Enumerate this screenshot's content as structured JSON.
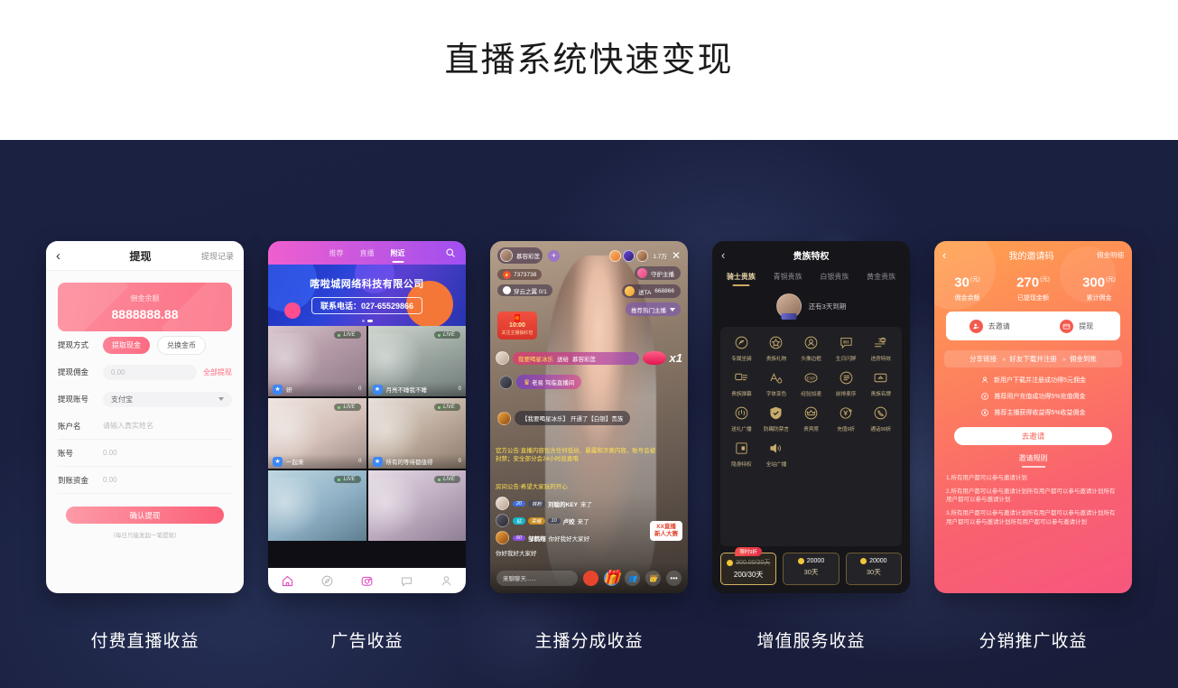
{
  "header": {
    "title": "直播系统快速变现"
  },
  "captions": [
    "付费直播收益",
    "广告收益",
    "主播分成收益",
    "增值服务收益",
    "分销推广收益"
  ],
  "phone_withdraw": {
    "nav": {
      "back": "‹",
      "title": "提现",
      "right": "提现记录"
    },
    "balance_label": "佣金余额",
    "balance_value": "8888888.88",
    "method_label": "提现方式",
    "method_cash": "提取现金",
    "method_coin": "兑换金币",
    "amount_label": "提现佣金",
    "amount_placeholder": "0.00",
    "amount_all": "全部提现",
    "account_label": "提现账号",
    "account_value": "支付宝",
    "name_label": "账户名",
    "name_placeholder": "请输入真实姓名",
    "number_label": "账号",
    "number_placeholder": "0.00",
    "arrive_label": "到账资金",
    "arrive_placeholder": "0.00",
    "submit": "确认提现",
    "note": "（每日只能发起一笔提现）"
  },
  "phone_ads": {
    "tabs": [
      "推荐",
      "直播",
      "附近"
    ],
    "active_tab": "附近",
    "search_icon": "search-icon",
    "banner_title": "喀啦城网络科技有限公司",
    "banner_phone": "联系电话：027-65529866",
    "live_badge": "LIVE",
    "cards": [
      {
        "name": "妍",
        "viewers": "0"
      },
      {
        "name": "月亮不睡我不睡",
        "viewers": "0"
      },
      {
        "name": "一起来",
        "viewers": "0"
      },
      {
        "name": "所有的等待都值得",
        "viewers": "0"
      },
      {
        "name": "",
        "viewers": ""
      },
      {
        "name": "",
        "viewers": ""
      }
    ],
    "tabbar": [
      "home-icon",
      "compass-icon",
      "camera-icon",
      "chat-icon",
      "profile-icon"
    ]
  },
  "phone_live": {
    "anchor_name": "慕容彩莲",
    "follow_plus": "+",
    "viewer_count": "1.7万",
    "close_icon": "close-icon",
    "hot_value": "7373738",
    "task_text": "穿云之翼 0/1",
    "guard_label": "守护主播",
    "send_label": "送TA",
    "send_value": "668866",
    "recommend_label": "推荐热门主播",
    "redpacket_time": "10:00",
    "redpacket_text": "关注主播抽红包",
    "gift_sender": "我要喝星冰乐",
    "gift_action": "送给",
    "gift_target": "慕容彩莲",
    "gift_multi": "x1",
    "enter_user": "老易",
    "enter_text": "驾临直播间",
    "noble_user": "【我要喝星冰乐】",
    "noble_text": "开通了【白银】贵族",
    "official_notice": "官方公告:直播内容包含任何低俗、暴露和涉黄内容，账号会被封禁；安全部分会24小时巡查哦",
    "room_notice": "房间公告:希望大家玩的开心",
    "chat": [
      {
        "level": "20",
        "tag": "铁粉",
        "user": "刘聪的KEY",
        "text": "来了"
      },
      {
        "level": "钻",
        "tag": "荣耀",
        "tag2": "10",
        "user": "卢姣",
        "text": "来了"
      },
      {
        "level": "60",
        "user": "邹鹤翔",
        "text": "你好我好大家好"
      },
      {
        "user": "",
        "text": "你好我好大家好"
      }
    ],
    "ad_badge_line1": "XX直播",
    "ad_badge_line2": "新人大赛",
    "input_placeholder": "来聊聊天......"
  },
  "phone_noble": {
    "nav_title": "贵族特权",
    "back": "‹",
    "tabs": [
      "骑士贵族",
      "青铜贵族",
      "白银贵族",
      "黄金贵族"
    ],
    "active_tab": "骑士贵族",
    "expiry": "还有3天到期",
    "privileges": [
      {
        "label": "专属坐骑",
        "icon": "mount-icon"
      },
      {
        "label": "贵族礼物",
        "icon": "star-icon"
      },
      {
        "label": "头像边框",
        "icon": "avatar-frame-icon"
      },
      {
        "label": "生日闪屏",
        "icon": "hi-bubble-icon"
      },
      {
        "label": "进房特效",
        "icon": "enter-effect-icon"
      },
      {
        "label": "贵族弹幕",
        "icon": "danmaku-icon"
      },
      {
        "label": "字体变色",
        "icon": "font-color-icon"
      },
      {
        "label": "经验加速",
        "icon": "exp-icon"
      },
      {
        "label": "前排麦序",
        "icon": "queue-icon"
      },
      {
        "label": "贵族名牌",
        "icon": "nameplate-icon"
      },
      {
        "label": "送礼广播",
        "icon": "broadcast-icon"
      },
      {
        "label": "防踢防禁言",
        "icon": "shield-icon"
      },
      {
        "label": "贵宾席",
        "icon": "crown-icon"
      },
      {
        "label": "充值9折",
        "icon": "recharge-discount-icon"
      },
      {
        "label": "通话99折",
        "icon": "call-discount-icon"
      },
      {
        "label": "隐身特权",
        "icon": "invisible-icon"
      },
      {
        "label": "全站广播",
        "icon": "speaker-icon"
      }
    ],
    "prices": [
      {
        "badge": "限时9折",
        "old": "300.00/30天",
        "main": "200/30天",
        "selected": true
      },
      {
        "badge": "",
        "coin_value": "20000",
        "sub": "30天",
        "selected": false
      },
      {
        "badge": "",
        "coin_value": "20000",
        "sub": "30天",
        "selected": false
      }
    ]
  },
  "phone_invite": {
    "back": "‹",
    "title": "我的邀请码",
    "right": "佣金明细",
    "stats": [
      {
        "value": "30",
        "unit": "(元)",
        "label": "佣金余额"
      },
      {
        "value": "270",
        "unit": "(元)",
        "label": "已提现金额"
      },
      {
        "value": "300",
        "unit": "(元)",
        "label": "累计佣金"
      }
    ],
    "actions": [
      {
        "label": "去邀请",
        "icon": "invite-user-icon"
      },
      {
        "label": "提现",
        "icon": "card-icon"
      }
    ],
    "flow": [
      "分享链接",
      "好友下载并注册",
      "佣金到账"
    ],
    "flow_sep": "»",
    "rules": [
      {
        "icon": "user-icon",
        "text": "新用户下载并注册成功得5元佣金"
      },
      {
        "icon": "recharge-icon",
        "text": "推荐用户充值成功得5%充值佣金"
      },
      {
        "icon": "income-icon",
        "text": "推荐主播获得收益得5%收益佣金"
      }
    ],
    "cta": "去邀请",
    "rules_title": "邀请规则",
    "rule_items": [
      "1.所有用户都可以参与邀请计划",
      "2.所有用户都可以参与邀请计划所有用户都可以参与邀请计划所有用户都可以参与邀请计划",
      "3.所有用户都可以参与邀请计划所有用户都可以参与邀请计划所有用户都可以参与邀请计划所有用户都可以参与邀请计划"
    ]
  }
}
